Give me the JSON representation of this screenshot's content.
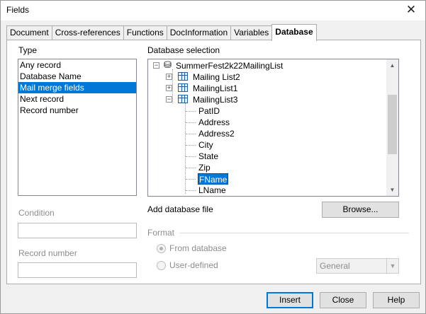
{
  "window": {
    "title": "Fields",
    "close_glyph": "✕"
  },
  "tabs": [
    {
      "label": "Document",
      "active": false
    },
    {
      "label": "Cross-references",
      "active": false
    },
    {
      "label": "Functions",
      "active": false
    },
    {
      "label": "DocInformation",
      "active": false
    },
    {
      "label": "Variables",
      "active": false
    },
    {
      "label": "Database",
      "active": true
    }
  ],
  "type_section": {
    "label": "Type",
    "items": [
      "Any record",
      "Database Name",
      "Mail merge fields",
      "Next record",
      "Record number"
    ],
    "selected": "Mail merge fields"
  },
  "condition": {
    "label": "Condition",
    "value": ""
  },
  "record_number": {
    "label": "Record number",
    "value": ""
  },
  "database_selection": {
    "label": "Database selection",
    "root": "SummerFest2k22MailingList",
    "tables": [
      {
        "name": "Mailing List2",
        "expander": "+"
      },
      {
        "name": "MailingList1",
        "expander": "+"
      },
      {
        "name": "MailingList3",
        "expander": "−"
      }
    ],
    "fields": [
      "PatID",
      "Address",
      "Address2",
      "City",
      "State",
      "Zip",
      "FName",
      "LName"
    ],
    "selected_field": "FName"
  },
  "add_database_file": {
    "label": "Add database file",
    "browse_label": "Browse..."
  },
  "format": {
    "label": "Format",
    "options": [
      {
        "label": "From database",
        "checked": true
      },
      {
        "label": "User-defined",
        "checked": false
      }
    ],
    "format_select": "General"
  },
  "buttons": {
    "insert": "Insert",
    "close": "Close",
    "help": "Help"
  },
  "icons": {
    "database": "database-icon",
    "table": "table-icon",
    "scroll_up": "▲",
    "scroll_down": "▼",
    "dropdown": "▼"
  },
  "colors": {
    "selection": "#0078d7",
    "default_button_border": "#0078d7"
  }
}
